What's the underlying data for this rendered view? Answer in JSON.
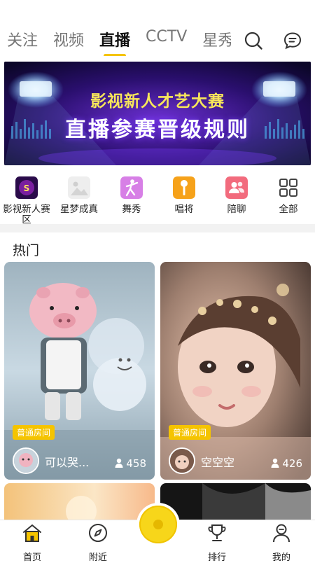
{
  "top_tabs": [
    "关注",
    "视频",
    "直播",
    "CCTV",
    "星秀"
  ],
  "active_tab_index": 2,
  "icons": {
    "search": "search-icon",
    "message": "message-icon"
  },
  "banner": {
    "line1": "影视新人才艺大赛",
    "line2": "直播参赛晋级规则"
  },
  "categories": [
    {
      "label": "影视新人赛区",
      "icon": "film-contest-icon"
    },
    {
      "label": "星梦成真",
      "icon": "image-placeholder-icon"
    },
    {
      "label": "舞秀",
      "icon": "dance-icon"
    },
    {
      "label": "唱将",
      "icon": "microphone-icon"
    },
    {
      "label": "陪聊",
      "icon": "chat-people-icon"
    },
    {
      "label": "全部",
      "icon": "grid-icon"
    }
  ],
  "section_title": "热门",
  "rooms": [
    {
      "badge": "普通房间",
      "name": "可以哭...",
      "viewers": "458"
    },
    {
      "badge": "普通房间",
      "name": "空空空",
      "viewers": "426"
    }
  ],
  "bottom_nav": [
    {
      "label": "首页",
      "icon": "home-icon"
    },
    {
      "label": "附近",
      "icon": "compass-icon"
    },
    {
      "label": "",
      "icon": "live-record-button"
    },
    {
      "label": "排行",
      "icon": "trophy-icon"
    },
    {
      "label": "我的",
      "icon": "profile-icon"
    }
  ],
  "colors": {
    "accent": "#F5C400",
    "banner_bg": "#1b0b45"
  }
}
